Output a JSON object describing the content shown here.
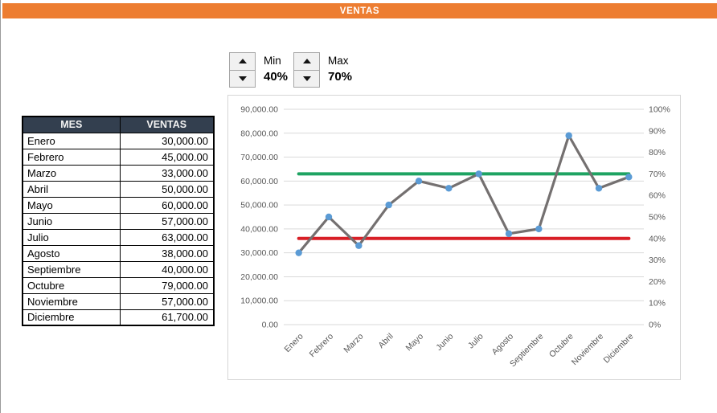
{
  "title_bar": {
    "title": "VENTAS",
    "color": "#ED7D31"
  },
  "controls": {
    "min": {
      "label": "Min",
      "value": "40%"
    },
    "max": {
      "label": "Max",
      "value": "70%"
    }
  },
  "table": {
    "headers": [
      "MES",
      "VENTAS"
    ],
    "rows": [
      [
        "Enero",
        "30,000.00"
      ],
      [
        "Febrero",
        "45,000.00"
      ],
      [
        "Marzo",
        "33,000.00"
      ],
      [
        "Abril",
        "50,000.00"
      ],
      [
        "Mayo",
        "60,000.00"
      ],
      [
        "Junio",
        "57,000.00"
      ],
      [
        "Julio",
        "63,000.00"
      ],
      [
        "Agosto",
        "38,000.00"
      ],
      [
        "Septiembre",
        "40,000.00"
      ],
      [
        "Octubre",
        "79,000.00"
      ],
      [
        "Noviembre",
        "57,000.00"
      ],
      [
        "Diciembre",
        "61,700.00"
      ]
    ]
  },
  "chart_data": {
    "type": "line",
    "title": "",
    "categories": [
      "Enero",
      "Febrero",
      "Marzo",
      "Abril",
      "Mayo",
      "Junio",
      "Julio",
      "Agosto",
      "Septiembre",
      "Octubre",
      "Noviembre",
      "Diciembre"
    ],
    "series": [
      {
        "name": "VENTAS",
        "values": [
          30000,
          45000,
          33000,
          50000,
          60000,
          57000,
          63000,
          38000,
          40000,
          79000,
          57000,
          61700
        ],
        "line_color": "#747070",
        "marker_color": "#5B9BD5"
      },
      {
        "name": "Max",
        "type": "reference",
        "value": 63000,
        "percent": "70%",
        "color": "#1EA362"
      },
      {
        "name": "Min",
        "type": "reference",
        "value": 36000,
        "percent": "40%",
        "color": "#D81F26"
      }
    ],
    "left_axis": {
      "min": 0,
      "max": 90000,
      "step": 10000,
      "tick_labels": [
        "0.00",
        "10,000.00",
        "20,000.00",
        "30,000.00",
        "40,000.00",
        "50,000.00",
        "60,000.00",
        "70,000.00",
        "80,000.00",
        "90,000.00"
      ]
    },
    "right_axis": {
      "min": 0,
      "max": 1,
      "step": 0.1,
      "tick_labels": [
        "0%",
        "10%",
        "20%",
        "30%",
        "40%",
        "50%",
        "60%",
        "70%",
        "80%",
        "90%",
        "100%"
      ]
    },
    "grid": true,
    "legend": "none",
    "grid_color": "#D9D9D9",
    "axis_text_color": "#595959"
  }
}
